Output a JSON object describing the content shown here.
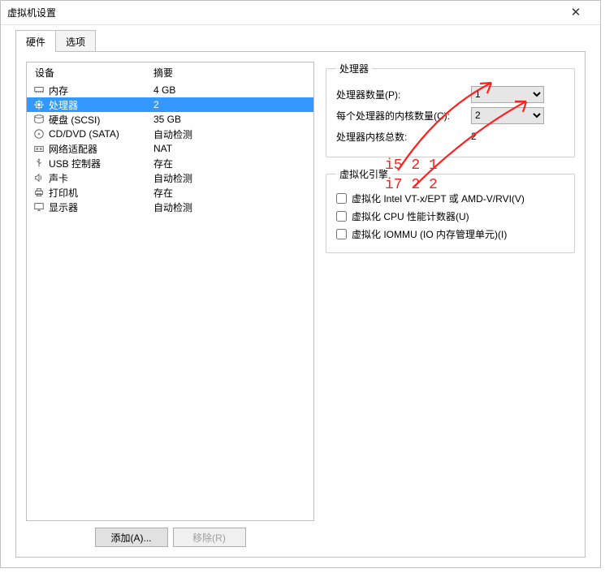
{
  "window": {
    "title": "虚拟机设置",
    "close_label": "✕"
  },
  "tabs": {
    "hardware": "硬件",
    "options": "选项"
  },
  "device_list": {
    "header_device": "设备",
    "header_summary": "摘要",
    "rows": [
      {
        "name": "内存",
        "summary": "4 GB",
        "icon": "memory"
      },
      {
        "name": "处理器",
        "summary": "2",
        "icon": "cpu",
        "selected": true
      },
      {
        "name": "硬盘 (SCSI)",
        "summary": "35 GB",
        "icon": "disk"
      },
      {
        "name": "CD/DVD (SATA)",
        "summary": "自动检测",
        "icon": "cd"
      },
      {
        "name": "网络适配器",
        "summary": "NAT",
        "icon": "network"
      },
      {
        "name": "USB 控制器",
        "summary": "存在",
        "icon": "usb"
      },
      {
        "name": "声卡",
        "summary": "自动检测",
        "icon": "sound"
      },
      {
        "name": "打印机",
        "summary": "存在",
        "icon": "printer"
      },
      {
        "name": "显示器",
        "summary": "自动检测",
        "icon": "display"
      }
    ]
  },
  "buttons": {
    "add": "添加(A)...",
    "remove": "移除(R)"
  },
  "processor": {
    "group_title": "处理器",
    "count_label": "处理器数量(P):",
    "count_value": "1",
    "cores_label": "每个处理器的内核数量(C):",
    "cores_value": "2",
    "total_label": "处理器内核总数:",
    "total_value": "2"
  },
  "virtengine": {
    "group_title": "虚拟化引擎",
    "vt_label": "虚拟化 Intel VT-x/EPT 或 AMD-V/RVI(V)",
    "cpu_perf_label": "虚拟化 CPU 性能计数器(U)",
    "iommu_label": "虚拟化 IOMMU (IO 内存管理单元)(I)"
  },
  "annotations": {
    "text1": "i5 2 1",
    "text2": "i7 2 2"
  }
}
